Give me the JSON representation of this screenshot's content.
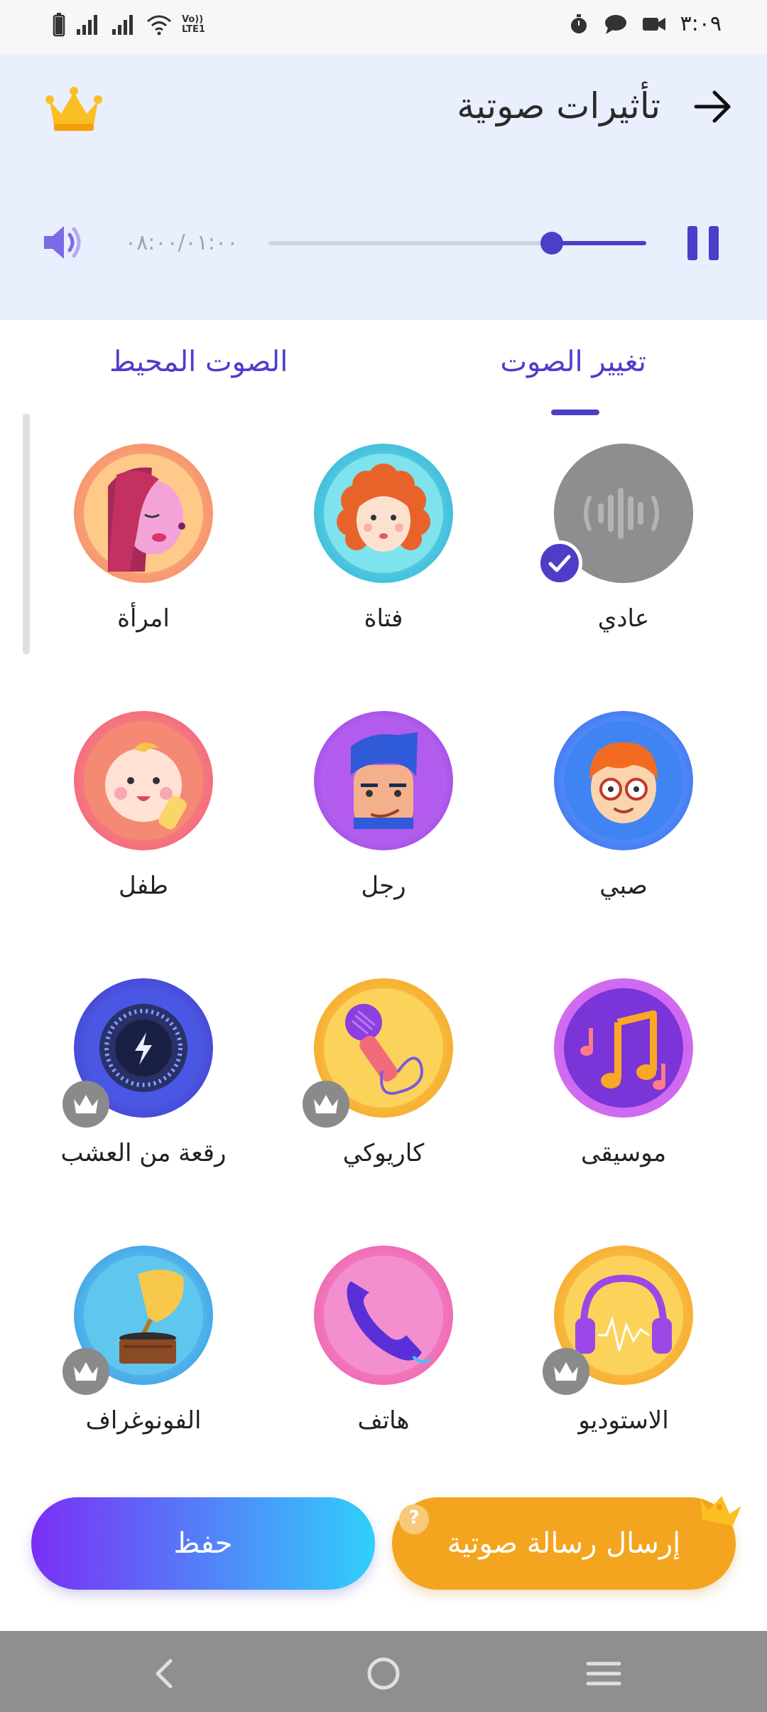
{
  "status_bar": {
    "time": "٣:٠٩",
    "network_label": "Vo)) LTE1",
    "icons": [
      "battery-icon",
      "signal-icon",
      "signal-icon",
      "wifi-icon",
      "volte-icon",
      "timer-icon",
      "message-icon",
      "video-icon"
    ]
  },
  "header": {
    "title": "تأثيرات صوتية",
    "back_icon": "arrow-right-icon",
    "premium_icon": "crown-icon"
  },
  "player": {
    "time_display": "٠٨:٠٠/٠١:٠٠",
    "progress": 0.75,
    "speaker_icon": "speaker-icon",
    "pause_icon": "pause-icon"
  },
  "tabs": [
    {
      "label": "تغيير الصوت",
      "selected": true
    },
    {
      "label": "الصوت المحيط",
      "selected": false
    }
  ],
  "effects": [
    {
      "label": "عادي",
      "icon": "soundwave-icon",
      "selected": true,
      "premium": false
    },
    {
      "label": "فتاة",
      "icon": "girl-face-icon",
      "selected": false,
      "premium": false
    },
    {
      "label": "امرأة",
      "icon": "woman-face-icon",
      "selected": false,
      "premium": false
    },
    {
      "label": "صبي",
      "icon": "boy-face-icon",
      "selected": false,
      "premium": false
    },
    {
      "label": "رجل",
      "icon": "man-face-icon",
      "selected": false,
      "premium": false
    },
    {
      "label": "طفل",
      "icon": "baby-face-icon",
      "selected": false,
      "premium": false
    },
    {
      "label": "موسيقى",
      "icon": "music-notes-icon",
      "selected": false,
      "premium": false
    },
    {
      "label": "كاريوكي",
      "icon": "microphone-icon",
      "selected": false,
      "premium": true
    },
    {
      "label": "رقعة من العشب",
      "icon": "knob-icon",
      "selected": false,
      "premium": true
    },
    {
      "label": "الاستوديو",
      "icon": "headphones-icon",
      "selected": false,
      "premium": true
    },
    {
      "label": "هاتف",
      "icon": "phone-icon",
      "selected": false,
      "premium": false
    },
    {
      "label": "الفونوغراف",
      "icon": "gramophone-icon",
      "selected": false,
      "premium": true
    }
  ],
  "buttons": {
    "save_label": "حفظ",
    "send_label": "إرسال رسالة صوتية",
    "help_glyph": "?"
  },
  "colors": {
    "accent": "#4d3ec9",
    "header_bg": "#e9effd",
    "send_button": "#f3a51f",
    "save_gradient": [
      "#7a2ff6",
      "#2fd0fb"
    ]
  },
  "navbar": {
    "icons": [
      "back-chevron-icon",
      "home-circle-icon",
      "menu-lines-icon"
    ]
  }
}
